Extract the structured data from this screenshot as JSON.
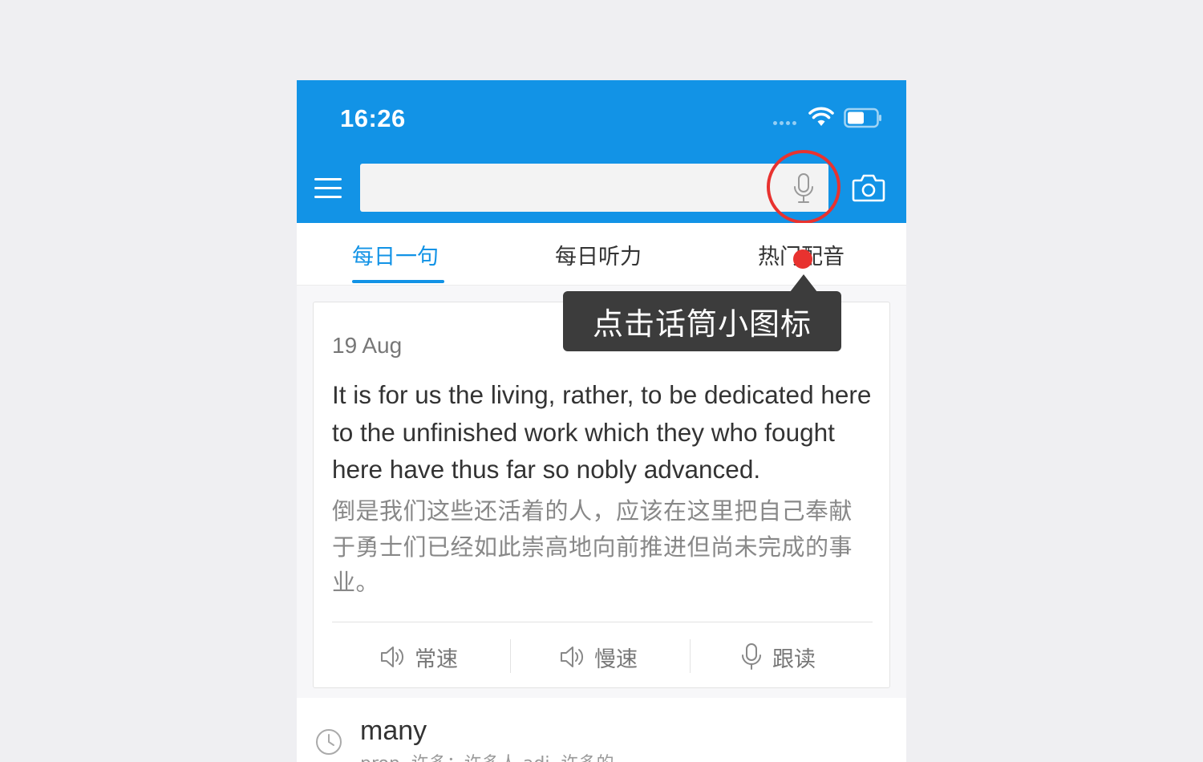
{
  "status_bar": {
    "time": "16:26"
  },
  "search": {
    "value": "",
    "placeholder": ""
  },
  "tabs": [
    {
      "label": "每日一句",
      "active": true
    },
    {
      "label": "每日听力",
      "active": false
    },
    {
      "label": "热门配音",
      "active": false
    }
  ],
  "tooltip": {
    "text": "点击话筒小图标"
  },
  "daily_sentence": {
    "date": "19 Aug",
    "english": "It is for us the living, rather, to be dedicated here to the unfinished work which they who fought here have thus far so nobly advanced.",
    "chinese": "倒是我们这些还活着的人，应该在这里把自己奉献于勇士们已经如此崇高地向前推进但尚未完成的事业。",
    "actions": [
      {
        "label": "常速",
        "icon": "speaker-icon"
      },
      {
        "label": "慢速",
        "icon": "speaker-icon"
      },
      {
        "label": "跟读",
        "icon": "microphone-icon"
      }
    ]
  },
  "history": {
    "word": "many",
    "definition": "pron. 许多；许多人 adj. 许多的"
  },
  "colors": {
    "brand_blue": "#1293e6",
    "highlight_red": "#e8322f",
    "tooltip_bg": "#3c3c3c"
  }
}
